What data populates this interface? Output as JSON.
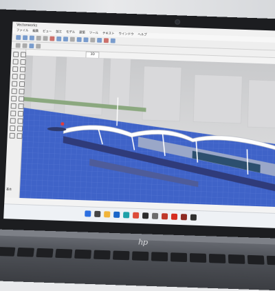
{
  "app": {
    "title": "Vectorworks",
    "menu": [
      "ファイル",
      "編集",
      "ビュー",
      "加工",
      "モデル",
      "建築",
      "ツール",
      "テキスト",
      "ウインドウ",
      "ヘルプ"
    ],
    "document_tab": "3D",
    "left_panel_label": "基本"
  },
  "laptop": {
    "brand": "hp"
  },
  "colors": {
    "accent": "#3a5fbf",
    "water": "#3f63c8",
    "sky": "#c8c9cb",
    "roof": "#ffffff",
    "taskbar": "#eef1f5"
  },
  "taskbar_icons": [
    {
      "name": "windows-start-icon",
      "color": "#2d6fe0"
    },
    {
      "name": "search-icon",
      "color": "#444444"
    },
    {
      "name": "file-explorer-icon",
      "color": "#f1b43b"
    },
    {
      "name": "mail-icon",
      "color": "#1b66c9"
    },
    {
      "name": "edge-browser-icon",
      "color": "#1fa0a8"
    },
    {
      "name": "chrome-icon",
      "color": "#dd4b39"
    },
    {
      "name": "store-icon",
      "color": "#2b2b2b"
    },
    {
      "name": "settings-icon",
      "color": "#6c6c6c"
    },
    {
      "name": "app-icon-red",
      "color": "#c0392b"
    },
    {
      "name": "acrobat-icon",
      "color": "#d62d20"
    },
    {
      "name": "cad-app-icon",
      "color": "#8e2a22"
    },
    {
      "name": "app-icon-dark",
      "color": "#303030"
    }
  ]
}
